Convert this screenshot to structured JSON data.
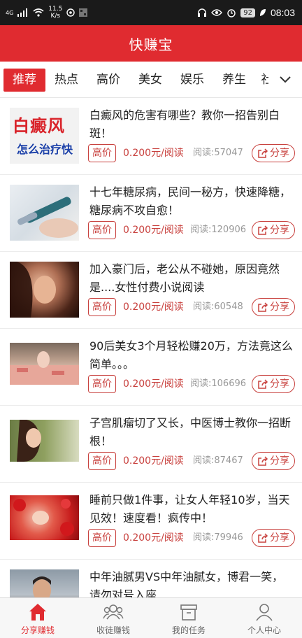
{
  "status_bar": {
    "signal": "4G",
    "speed": "11.5",
    "speed_unit": "K/s",
    "battery": "92",
    "time": "08:03"
  },
  "header": {
    "title": "快赚宝"
  },
  "tabs": [
    {
      "label": "推荐",
      "active": true
    },
    {
      "label": "热点"
    },
    {
      "label": "高价"
    },
    {
      "label": "美女"
    },
    {
      "label": "娱乐"
    },
    {
      "label": "养生"
    },
    {
      "label": "社"
    }
  ],
  "articles": [
    {
      "title": "白癜风的危害有哪些？教你一招告别白斑！",
      "thumb_text_top": "白癜风",
      "thumb_text_bottom": "怎么治疗快",
      "badge": "高价",
      "price": "0.200元/阅读",
      "reads": "阅读:57047",
      "share": "分享"
    },
    {
      "title": "十七年糖尿病，民间一秘方，快速降糖，糖尿病不攻自愈！",
      "badge": "高价",
      "price": "0.200元/阅读",
      "reads": "阅读:120906",
      "share": "分享"
    },
    {
      "title": "加入豪门后，老公从不碰她，原因竟然是....女性付费小说阅读",
      "badge": "高价",
      "price": "0.200元/阅读",
      "reads": "阅读:60548",
      "share": "分享"
    },
    {
      "title": "90后美女3个月轻松赚20万，方法竟这么简单。。。",
      "badge": "高价",
      "price": "0.200元/阅读",
      "reads": "阅读:106696",
      "share": "分享"
    },
    {
      "title": "子宫肌瘤切了又长，中医博士教你一招断根！",
      "badge": "高价",
      "price": "0.200元/阅读",
      "reads": "阅读:87467",
      "share": "分享"
    },
    {
      "title": "睡前只做1件事，让女人年轻10岁，当天见效！速度看！疯传中！",
      "badge": "高价",
      "price": "0.200元/阅读",
      "reads": "阅读:79946",
      "share": "分享"
    },
    {
      "title": "中年油腻男VS中年油腻女，博君一笑，请勿对号入座"
    }
  ],
  "bottom_nav": [
    {
      "label": "分享赚钱",
      "icon": "home-icon",
      "active": true
    },
    {
      "label": "收徒赚钱",
      "icon": "group-icon"
    },
    {
      "label": "我的任务",
      "icon": "task-box-icon"
    },
    {
      "label": "个人中心",
      "icon": "person-icon"
    }
  ],
  "colors": {
    "brand_red": "#e02b30",
    "price_red": "#c8403d",
    "muted": "#999999"
  }
}
